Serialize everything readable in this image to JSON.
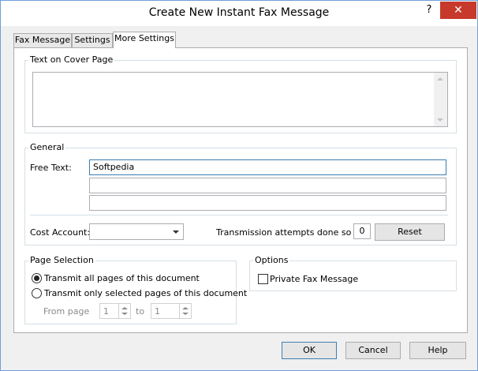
{
  "window": {
    "title": "Create New Instant Fax Message",
    "help_glyph": "?",
    "close_glyph": "✕"
  },
  "tabs": [
    {
      "label": "Fax Message"
    },
    {
      "label": "Settings"
    },
    {
      "label": "More Settings",
      "active": true
    }
  ],
  "cover": {
    "group_label": "Text on Cover Page",
    "value": ""
  },
  "general": {
    "group_label": "General",
    "free_text_label": "Free Text:",
    "free_text_lines": [
      "Softpedia",
      "",
      ""
    ],
    "cost_account_label": "Cost Account:",
    "cost_account_value": "",
    "attempts_label": "Transmission attempts done so far:",
    "attempts_value": "0",
    "reset_label": "Reset"
  },
  "page_selection": {
    "group_label": "Page Selection",
    "option_all": "Transmit all pages of this document",
    "option_selected": "Transmit only selected pages of this document",
    "selected_option": "all",
    "from_label": "From page",
    "from_value": "1",
    "to_label": "to",
    "to_value": "1"
  },
  "options": {
    "group_label": "Options",
    "private_label": "Private Fax Message",
    "private_checked": false
  },
  "footer": {
    "ok": "OK",
    "cancel": "Cancel",
    "help": "Help"
  }
}
